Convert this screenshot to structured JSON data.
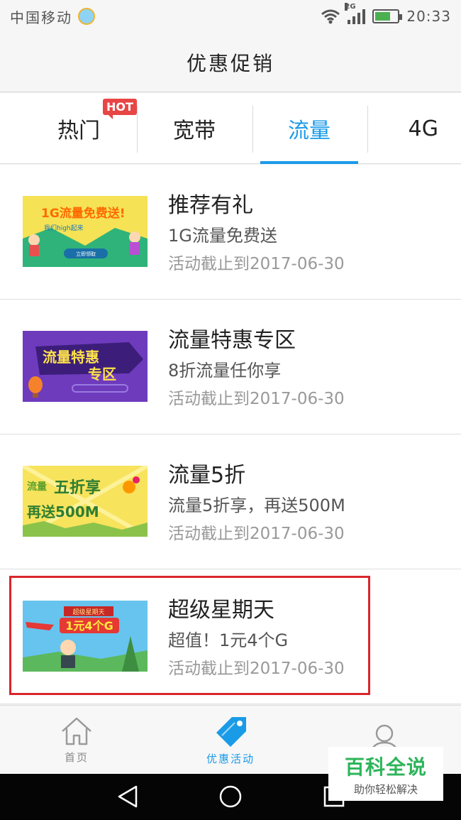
{
  "status_bar": {
    "carrier": "中国移动",
    "network_tag": "2G",
    "time": "20:33"
  },
  "header": {
    "title": "优惠促销"
  },
  "tabs": [
    {
      "label": "热门",
      "badge": "HOT"
    },
    {
      "label": "宽带"
    },
    {
      "label": "流量",
      "active": true
    },
    {
      "label": "4G"
    }
  ],
  "promos": [
    {
      "title": "推荐有礼",
      "subtitle": "1G流量免费送",
      "date": "活动截止到2017-06-30",
      "banner_text": [
        "1G流量免费送!",
        "我们high起来",
        "立即领取"
      ]
    },
    {
      "title": "流量特惠专区",
      "subtitle": "8折流量任你享",
      "date": "活动截止到2017-06-30",
      "banner_text": [
        "流量特惠",
        "专区"
      ]
    },
    {
      "title": "流量5折",
      "subtitle": "流量5折享，再送500M",
      "date": "活动截止到2017-06-30",
      "banner_text": [
        "流量",
        "五折享",
        "再送500M"
      ]
    },
    {
      "title": "超级星期天",
      "subtitle": "超值！1元4个G",
      "date": "活动截止到2017-06-30",
      "banner_text": [
        "超级星期天",
        "1元4个G"
      ]
    }
  ],
  "bottom_tabs": [
    {
      "label": "首页",
      "icon": "home-icon"
    },
    {
      "label": "优惠活动",
      "icon": "tag-icon",
      "active": true
    },
    {
      "label": "",
      "icon": "user-icon"
    }
  ],
  "watermark": {
    "title": "百科全说",
    "subtitle": "助你轻松解决"
  },
  "colors": {
    "accent": "#1a9be8",
    "highlight": "#d9262c",
    "hot": "#e84545"
  }
}
